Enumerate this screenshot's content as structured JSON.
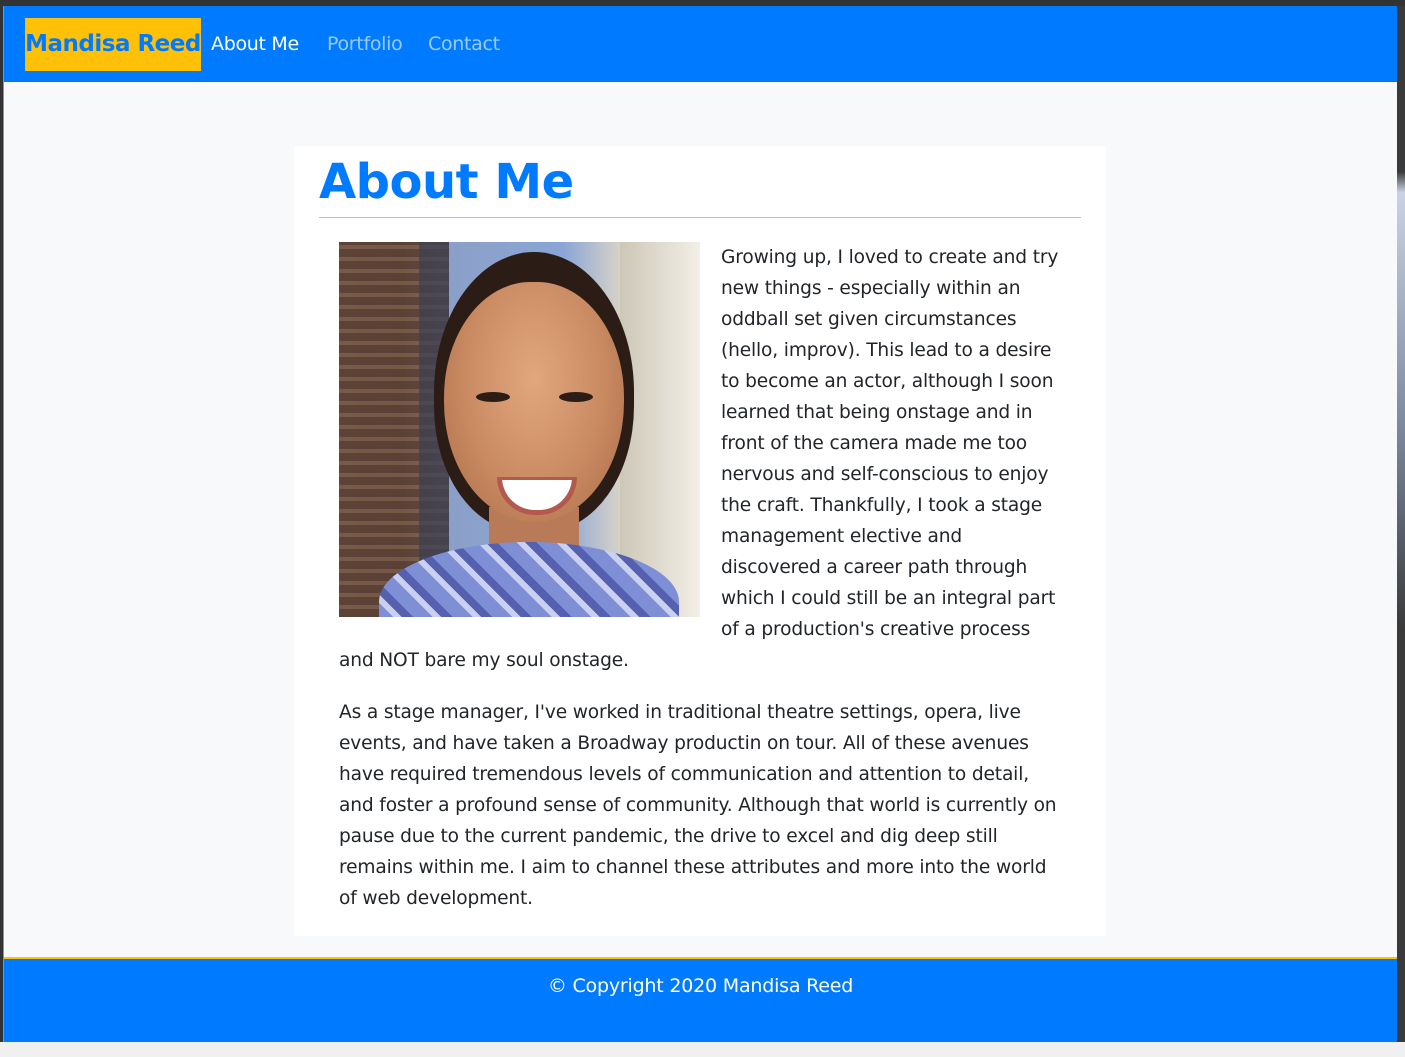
{
  "navbar": {
    "brand": "Mandisa Reed",
    "links": [
      {
        "label": "About Me",
        "active": true
      },
      {
        "label": "Portfolio",
        "active": false
      },
      {
        "label": "Contact",
        "active": false
      }
    ]
  },
  "main": {
    "title": "About Me",
    "photo_alt": "portrait-photo",
    "paragraphs": [
      "Growing up, I loved to create and try new things - especially within an oddball set given circumstances (hello, improv). This lead to a desire to become an actor, although I soon learned that being onstage and in front of the camera made me too nervous and self-conscious to enjoy the craft. Thankfully, I took a stage management elective and discovered a career path through which I could still be an integral part of a production's creative process and NOT bare my soul onstage.",
      "As a stage manager, I've worked in traditional theatre settings, opera, live events, and have taken a Broadway productin on tour. All of these avenues have required tremendous levels of communication and attention to detail, and foster a profound sense of community. Although that world is currently on pause due to the current pandemic, the drive to excel and dig deep still remains within me. I aim to channel these attributes and more into the world of web development."
    ]
  },
  "footer": {
    "copyright": "© Copyright 2020 Mandisa Reed"
  },
  "colors": {
    "primary": "#007bff",
    "accent": "#ffc107",
    "background": "#f8f9fa",
    "text": "#212529"
  }
}
